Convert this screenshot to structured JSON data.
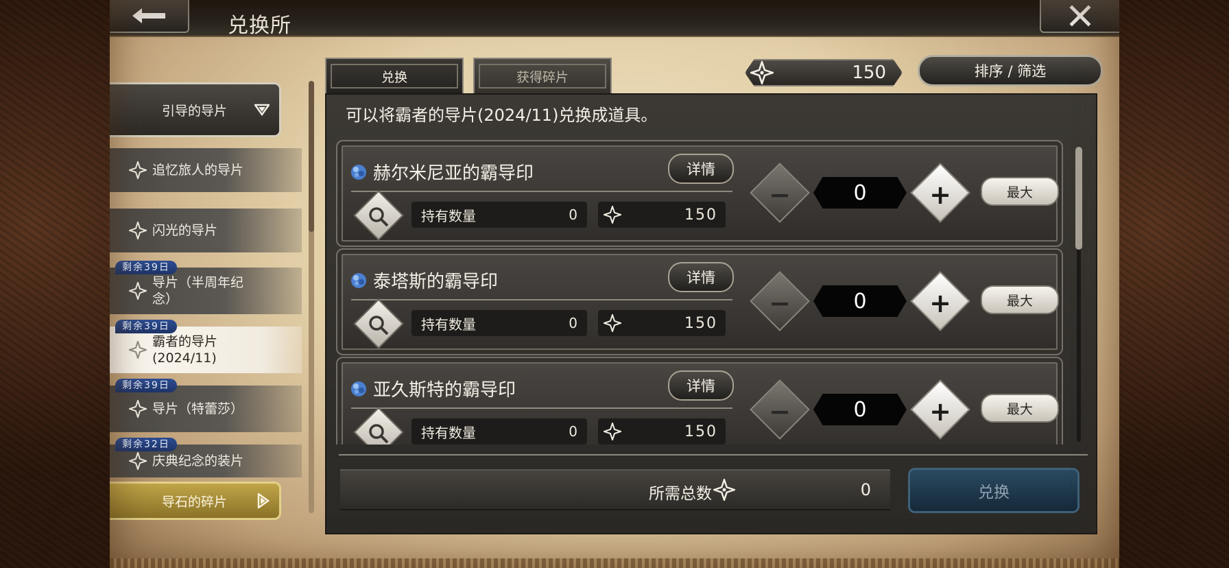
{
  "header": {
    "title": "兑换所"
  },
  "menu": {
    "category_top": "引导的导片",
    "items": [
      {
        "label": "追忆旅人的导片",
        "badge": ""
      },
      {
        "label": "闪光的导片",
        "badge": ""
      },
      {
        "label": "导片（半周年纪念）",
        "badge": "剩余39日"
      },
      {
        "label": "霸者的导片(2024/11)",
        "badge": "剩余39日"
      },
      {
        "label": "导片（特蕾莎）",
        "badge": "剩余39日"
      },
      {
        "label": "庆典纪念的装片",
        "badge": "剩余32日"
      }
    ],
    "category_bottom": "导石的碎片"
  },
  "tabs": [
    {
      "label": "兑换"
    },
    {
      "label": "获得碎片"
    }
  ],
  "currency": {
    "value": "150"
  },
  "sort_label": "排序 / 筛选",
  "description": "可以将霸者的导片(2024/11)兑换成道具。",
  "items": [
    {
      "name": "赫尔米尼亚的霸导印",
      "detail": "详情",
      "owned_label": "持有数量",
      "owned": "0",
      "cost": "150",
      "qty": "0",
      "max": "最大"
    },
    {
      "name": "泰塔斯的霸导印",
      "detail": "详情",
      "owned_label": "持有数量",
      "owned": "0",
      "cost": "150",
      "qty": "0",
      "max": "最大"
    },
    {
      "name": "亚久斯特的霸导印",
      "detail": "详情",
      "owned_label": "持有数量",
      "owned": "0",
      "cost": "150",
      "qty": "0",
      "max": "最大"
    }
  ],
  "total": {
    "label": "所需总数",
    "value": "0"
  },
  "exchange_button": "兑换",
  "colors": {
    "badge": "#2d4d92",
    "gold_category": "#c0a548",
    "exchange_button": "#2a4a60"
  },
  "icons": {
    "back": "back-arrow-icon",
    "close": "close-icon",
    "shard": "shard-star-icon",
    "gem": "blue-gem-icon",
    "zoom": "magnifier-icon"
  }
}
